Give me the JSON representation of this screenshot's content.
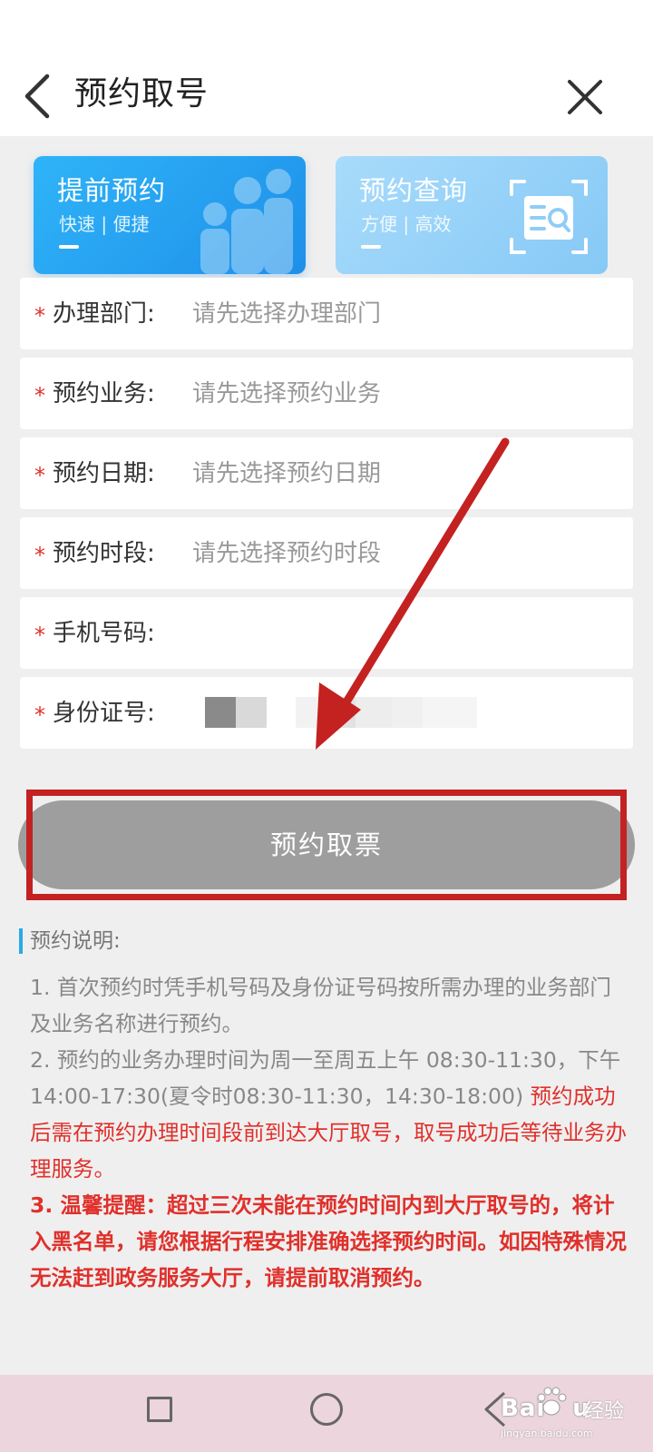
{
  "header": {
    "title": "预约取号"
  },
  "cards": [
    {
      "title": "提前预约",
      "subtitle": "快速 | 便捷"
    },
    {
      "title": "预约查询",
      "subtitle": "方便 | 高效"
    }
  ],
  "form": {
    "required_mark": "*",
    "fields": [
      {
        "label": "办理部门:",
        "placeholder": "请先选择办理部门"
      },
      {
        "label": "预约业务:",
        "placeholder": "请先选择预约业务"
      },
      {
        "label": "预约日期:",
        "placeholder": "请先选择预约日期"
      },
      {
        "label": "预约时段:",
        "placeholder": "请先选择预约时段"
      },
      {
        "label": "手机号码:",
        "placeholder": ""
      },
      {
        "label": "身份证号:",
        "placeholder": ""
      }
    ]
  },
  "submit": {
    "label": "预约取票"
  },
  "notes": {
    "title": "预约说明:",
    "item1": "1. 首次预约时凭手机号码及身份证号码按所需办理的业务部门及业务名称进行预约。",
    "item2_gray": "2. 预约的业务办理时间为周一至周五上午 08:30-11:30，下午14:00-17:30(夏令时08:30-11:30，14:30-18:00)",
    "item2_red": " 预约成功后需在预约办理时间段前到达大厅取号，取号成功后等待业务办理服务。",
    "item3": "3. 温馨提醒：超过三次未能在预约时间内到大厅取号的，将计入黑名单，请您根据行程安排准确选择预约时间。如因特殊情况无法赶到政务服务大厅，请提前取消预约。"
  },
  "watermark": {
    "brand": "Bai",
    "brand_end": "u",
    "cn": "经验",
    "url": "jingyan.baidu.com"
  },
  "colors": {
    "accent_blue": "#1e8fe9",
    "required_red": "#e0302b",
    "annotation_red": "#c42121",
    "button_gray": "#9e9e9e"
  },
  "icons": {
    "back": "chevron-left-icon",
    "close": "close-icon",
    "people": "people-group-icon",
    "search_doc": "search-document-icon"
  }
}
